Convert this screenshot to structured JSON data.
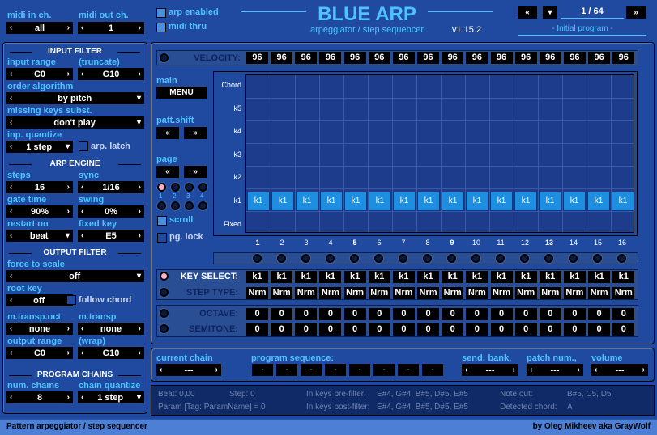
{
  "app": {
    "title": "BLUE ARP",
    "subtitle": "arpeggiator / step sequencer",
    "version": "v1.15.2",
    "footer_left": "Pattern arpeggiator / step sequencer",
    "footer_right": "by Oleg Mikheev aka GrayWolf"
  },
  "top": {
    "midi_in_label": "midi in ch.",
    "midi_in_value": "all",
    "midi_out_label": "midi out ch.",
    "midi_out_value": "1",
    "arp_enabled_label": "arp enabled",
    "midi_thru_label": "midi thru",
    "program_counter": "1 / 64",
    "program_name": "- Initial program -"
  },
  "input_filter": {
    "header": "INPUT FILTER",
    "input_range_label": "input range",
    "truncate_label": "(truncate)",
    "range_low": "C0",
    "range_high": "G10",
    "order_label": "order algorithm",
    "order_value": "by pitch",
    "missing_label": "missing keys subst.",
    "missing_value": "don't play",
    "quantize_label": "inp. quantize",
    "quantize_value": "1 step",
    "latch_label": "arp. latch"
  },
  "arp_engine": {
    "header": "ARP ENGINE",
    "steps_label": "steps",
    "steps_value": "16",
    "sync_label": "sync",
    "sync_value": "1/16",
    "gate_label": "gate time",
    "gate_value": "90%",
    "swing_label": "swing",
    "swing_value": "0%",
    "restart_label": "restart on",
    "restart_value": "beat",
    "fixed_label": "fixed key",
    "fixed_value": "E5"
  },
  "output_filter": {
    "header": "OUTPUT FILTER",
    "force_label": "force to scale",
    "force_value": "off",
    "root_label": "root key",
    "root_value": "off",
    "follow_label": "follow chord",
    "mtransp_oct_label": "m.transp.oct",
    "mtransp_oct_value": "none",
    "mtransp_label": "m.transp",
    "mtransp_value": "none",
    "out_range_label": "output range",
    "wrap_label": "(wrap)",
    "out_low": "C0",
    "out_high": "G10"
  },
  "program_chains": {
    "header": "PROGRAM CHAINS",
    "num_label": "num. chains",
    "num_value": "8",
    "quant_label": "chain quantize",
    "quant_value": "1 step"
  },
  "sequencer": {
    "velocity_label": "VELOCITY:",
    "velocity": [
      "96",
      "96",
      "96",
      "96",
      "96",
      "96",
      "96",
      "96",
      "96",
      "96",
      "96",
      "96",
      "96",
      "96",
      "96",
      "96"
    ],
    "main_label": "main",
    "menu_label": "MENU",
    "patt_shift_label": "patt.shift",
    "page_label": "page",
    "page_nums": [
      "1",
      "2",
      "3",
      "4"
    ],
    "scroll_label": "scroll",
    "pglock_label": "pg. lock",
    "row_labels": [
      "Chord",
      "k5",
      "k4",
      "k3",
      "k2",
      "k1",
      "Fixed"
    ],
    "step_notes": [
      "k1",
      "k1",
      "k1",
      "k1",
      "k1",
      "k1",
      "k1",
      "k1",
      "k1",
      "k1",
      "k1",
      "k1",
      "k1",
      "k1",
      "k1",
      "k1"
    ],
    "columns": [
      "1",
      "2",
      "3",
      "4",
      "5",
      "6",
      "7",
      "8",
      "9",
      "10",
      "11",
      "12",
      "13",
      "14",
      "15",
      "16"
    ],
    "key_select_label": "KEY SELECT:",
    "key_select": [
      "k1",
      "k1",
      "k1",
      "k1",
      "k1",
      "k1",
      "k1",
      "k1",
      "k1",
      "k1",
      "k1",
      "k1",
      "k1",
      "k1",
      "k1",
      "k1"
    ],
    "step_type_label": "STEP TYPE:",
    "step_type": [
      "Nrm",
      "Nrm",
      "Nrm",
      "Nrm",
      "Nrm",
      "Nrm",
      "Nrm",
      "Nrm",
      "Nrm",
      "Nrm",
      "Nrm",
      "Nrm",
      "Nrm",
      "Nrm",
      "Nrm",
      "Nrm"
    ],
    "octave_label": "OCTAVE:",
    "octave": [
      "0",
      "0",
      "0",
      "0",
      "0",
      "0",
      "0",
      "0",
      "0",
      "0",
      "0",
      "0",
      "0",
      "0",
      "0",
      "0"
    ],
    "semitone_label": "SEMITONE:",
    "semitone": [
      "0",
      "0",
      "0",
      "0",
      "0",
      "0",
      "0",
      "0",
      "0",
      "0",
      "0",
      "0",
      "0",
      "0",
      "0",
      "0"
    ]
  },
  "chains": {
    "current_label": "current chain",
    "current_value": "---",
    "sequence_label": "program sequence:",
    "sequence": [
      "-",
      "-",
      "-",
      "-",
      "-",
      "-",
      "-",
      "-"
    ],
    "bank_label": "send: bank,",
    "bank_value": "---",
    "patch_label": "patch num.,",
    "patch_value": "---",
    "volume_label": "volume",
    "volume_value": "---"
  },
  "status": {
    "beat": "Beat: 0,00",
    "step": "Step: 0",
    "param": "Param [Tag: ParamName] = 0",
    "prefilter_label": "In keys pre-filter:",
    "prefilter_value": "E#4, G#4, B#5, D#5, E#5",
    "postfilter_label": "In keys post-filter:",
    "postfilter_value": "E#4, G#4, B#5, D#5, E#5",
    "noteout_label": "Note out:",
    "noteout_value": "B#5, C5, D5",
    "chord_label": "Detected chord:",
    "chord_value": "A"
  },
  "colors": {
    "background": "#1f4aa0",
    "label_accent": "#4fc3ff",
    "active_step": "#1e8fe0",
    "led_on": "#ffb0c8"
  }
}
